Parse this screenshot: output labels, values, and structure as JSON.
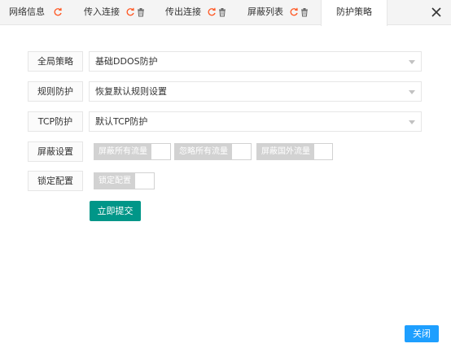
{
  "tabs": [
    {
      "label": "网络信息",
      "active": false
    },
    {
      "label": "传入连接",
      "active": false
    },
    {
      "label": "传出连接",
      "active": false
    },
    {
      "label": "屏蔽列表",
      "active": false
    },
    {
      "label": "防护策略",
      "active": true
    }
  ],
  "form": {
    "global_policy": {
      "label": "全局策略",
      "value": "基础DDOS防护"
    },
    "rule_protection": {
      "label": "规则防护",
      "value": "恢复默认规则设置"
    },
    "tcp_protection": {
      "label": "TCP防护",
      "value": "默认TCP防护"
    },
    "block_settings": {
      "label": "屏蔽设置",
      "switches": [
        "屏蔽所有流量",
        "忽略所有流量",
        "屏蔽国外流量"
      ]
    },
    "lock_config": {
      "label": "锁定配置",
      "switch": "锁定配置"
    }
  },
  "buttons": {
    "submit": "立即提交",
    "close": "关闭"
  },
  "colors": {
    "refresh_icon": "#ff5722",
    "submit_bg": "#009688",
    "close_bg": "#1e9fff",
    "switch_off": "#d2d2d2"
  }
}
